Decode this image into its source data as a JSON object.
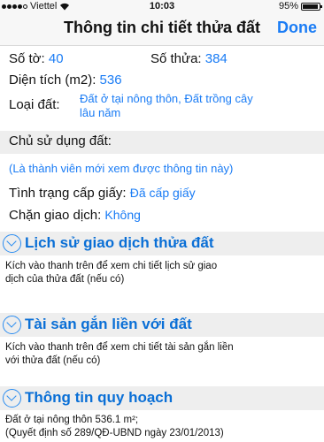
{
  "status": {
    "carrier": "Viettel",
    "time": "10:03",
    "battery": "95%",
    "battery_level": 0.95
  },
  "nav": {
    "title": "Thông tin chi tiết thửa đất",
    "done_label": "Done"
  },
  "parcel": {
    "so_to_label": "Số tờ:",
    "so_to_value": "40",
    "so_thua_label": "Số thửa:",
    "so_thua_value": "384",
    "dien_tich_label": "Diện tích (m2):",
    "dien_tich_value": "536",
    "loai_dat_label": "Loại đất:",
    "loai_dat_line1": "Đất ở tại nông thôn, Đất trồng cây",
    "loai_dat_line2": "lâu năm"
  },
  "owner": {
    "section_title": "Chủ sử dụng đất:",
    "member_note": "(Là thành viên mới xem được thông tin này)",
    "tinh_trang_label": "Tình trạng cấp giấy:",
    "tinh_trang_value": "Đã cấp giấy",
    "chan_label": "Chặn giao dịch:",
    "chan_value": "Không"
  },
  "sections": [
    {
      "title": "Lịch sử giao dịch thửa đất",
      "line1": "Kích vào thanh trên để xem chi tiết lịch sử giao",
      "line2": "dịch của thửa đất (nếu có)"
    },
    {
      "title": "Tài sản gắn liền với đất",
      "line1": "Kích vào thanh trên để xem chi tiết tài sản gắn liền",
      "line2": "với thửa đất (nếu có)"
    },
    {
      "title": "Thông tin quy hoạch",
      "line1": "Đất ở tại nông thôn 536.1 m²;",
      "line2": "(Quyết định số 289/QĐ-UBND ngày 23/01/2013)"
    }
  ]
}
